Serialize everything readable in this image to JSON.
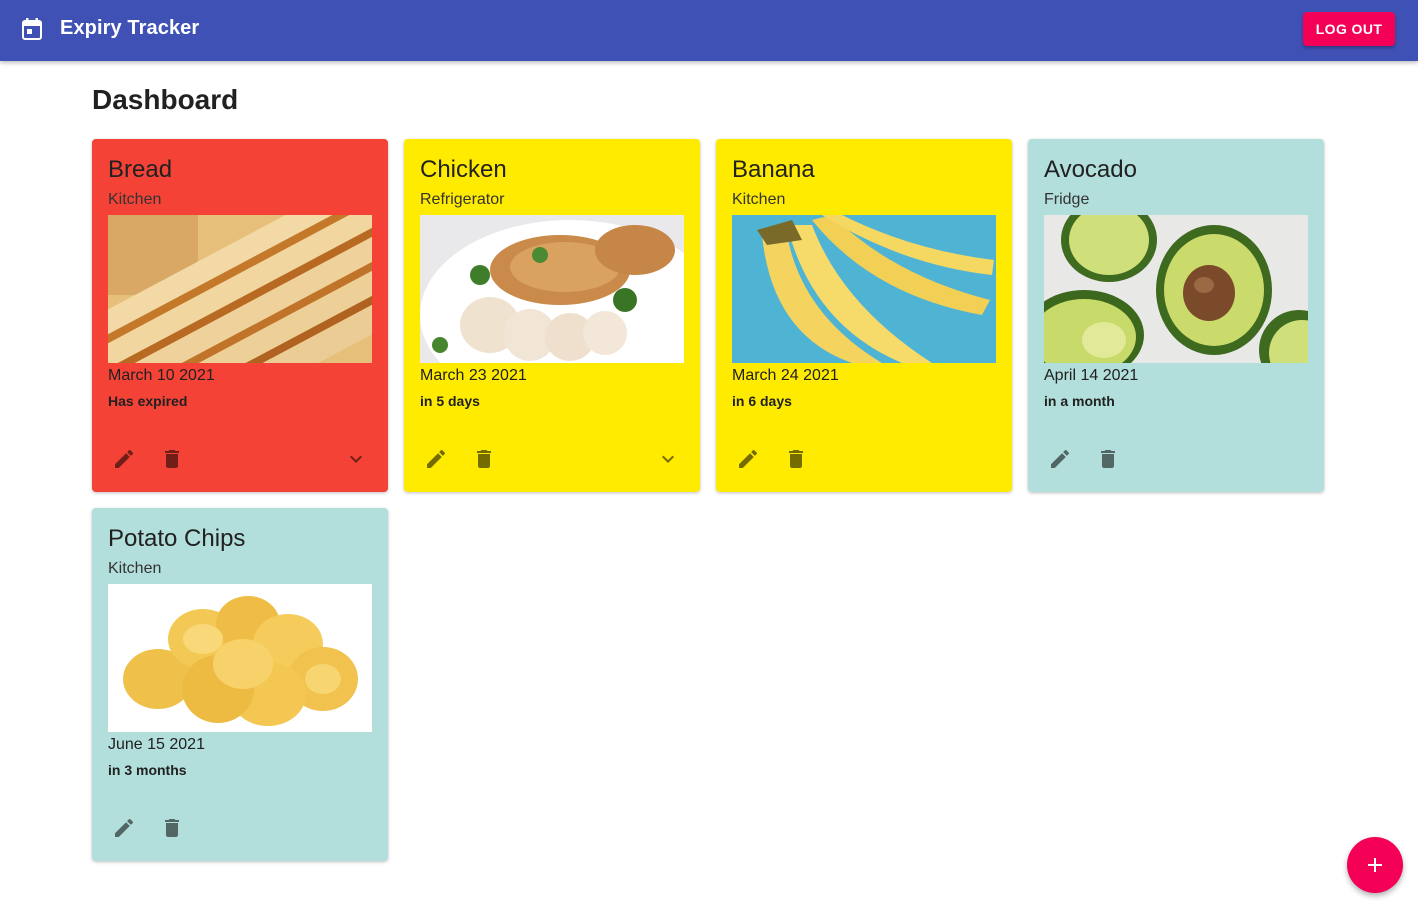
{
  "appbar": {
    "icon": "calendar-icon",
    "title": "Expiry Tracker",
    "logout_label": "LOG OUT",
    "color": "#3f51b5",
    "accent": "#f50057"
  },
  "page": {
    "title": "Dashboard"
  },
  "items": [
    {
      "name": "Bread",
      "location": "Kitchen",
      "date": "March 10 2021",
      "status": "Has expired",
      "color": "#f44336",
      "image": "bread"
    },
    {
      "name": "Chicken",
      "location": "Refrigerator",
      "date": "March 23 2021",
      "status": "in 5 days",
      "color": "#ffeb00",
      "image": "chicken"
    },
    {
      "name": "Banana",
      "location": "Kitchen",
      "date": "March 24 2021",
      "status": "in 6 days",
      "color": "#ffeb00",
      "image": "banana"
    },
    {
      "name": "Avocado",
      "location": "Fridge",
      "date": "April 14 2021",
      "status": "in a month",
      "color": "#b2dfdb",
      "image": "avocado"
    },
    {
      "name": "Potato Chips",
      "location": "Kitchen",
      "date": "June 15 2021",
      "status": "in 3 months",
      "color": "#b2dfdb",
      "image": "potato-chips"
    }
  ],
  "fab": {
    "icon": "plus-icon"
  }
}
